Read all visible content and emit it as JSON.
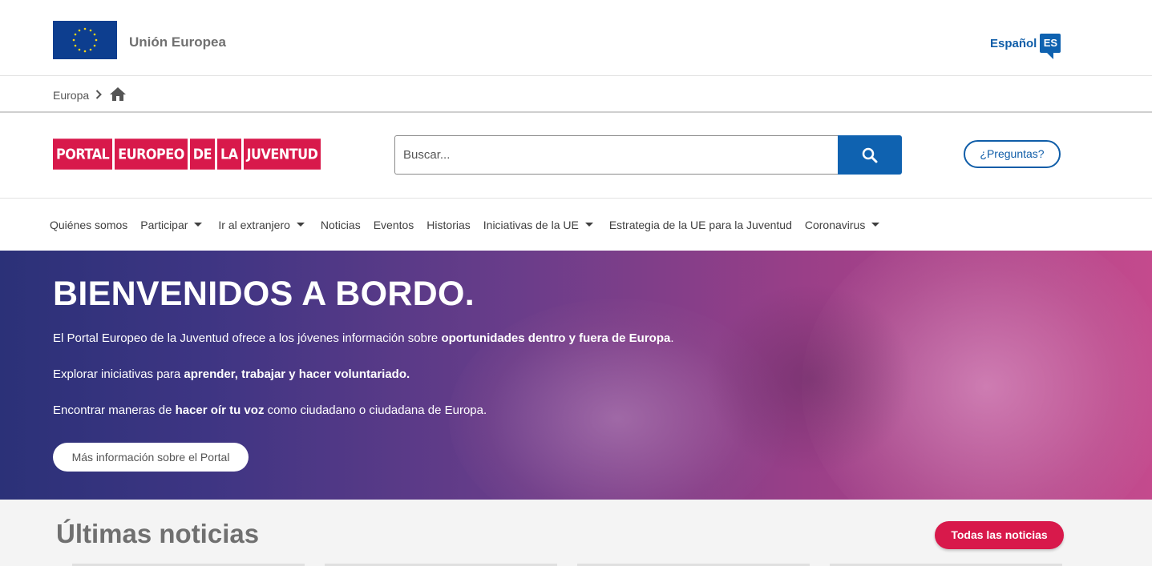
{
  "topbar": {
    "eu_name": "Unión Europea",
    "language_label": "Español",
    "language_code": "ES"
  },
  "breadcrumb": {
    "items": [
      "Europa"
    ]
  },
  "header": {
    "logo_words": [
      "PORTAL",
      "EUROPEO",
      "DE",
      "LA",
      "JUVENTUD"
    ],
    "search_placeholder": "Buscar...",
    "faq_label": "¿Preguntas?"
  },
  "nav": {
    "items": [
      {
        "label": "Quiénes somos",
        "dropdown": false
      },
      {
        "label": "Participar",
        "dropdown": true
      },
      {
        "label": "Ir al extranjero",
        "dropdown": true
      },
      {
        "label": "Noticias",
        "dropdown": false
      },
      {
        "label": "Eventos",
        "dropdown": false
      },
      {
        "label": "Historias",
        "dropdown": false
      },
      {
        "label": "Iniciativas de la UE",
        "dropdown": true
      },
      {
        "label": "Estrategia de la UE para la Juventud",
        "dropdown": false
      },
      {
        "label": "Coronavirus",
        "dropdown": true
      }
    ]
  },
  "hero": {
    "title": "BIENVENIDOS A BORDO.",
    "p1_start": "El Portal Europeo de la Juventud ofrece a los jóvenes información sobre ",
    "p1_bold": "oportunidades dentro y fuera de Europa",
    "p1_end": ".",
    "p2_start": "Explorar iniciativas para ",
    "p2_bold": "aprender, trabajar y hacer voluntariado.",
    "p3_start": "Encontrar maneras de ",
    "p3_bold": "hacer oír tu voz",
    "p3_end": " como ciudadano o ciudadana de Europa.",
    "button_label": "Más información sobre el Portal"
  },
  "news": {
    "title": "Últimas noticias",
    "all_button": "Todas las noticias"
  },
  "colors": {
    "brand_red": "#d8194b",
    "eu_blue": "#0f62b0"
  }
}
